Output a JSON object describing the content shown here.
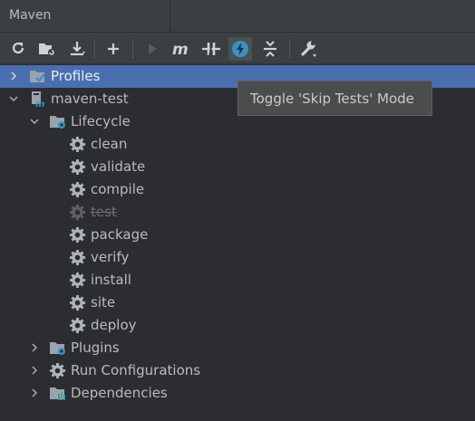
{
  "panel": {
    "title": "Maven"
  },
  "toolbar": {
    "buttons": [
      {
        "name": "reload-all-icon"
      },
      {
        "name": "add-project-folder-icon"
      },
      {
        "name": "download-icon"
      },
      {
        "name": "add-icon"
      },
      {
        "name": "run-icon",
        "disabled": true
      },
      {
        "name": "execute-goal-icon"
      },
      {
        "name": "toggle-offline-icon"
      },
      {
        "name": "skip-tests-icon",
        "active": true
      },
      {
        "name": "collapse-all-icon"
      },
      {
        "name": "settings-wrench-icon"
      }
    ]
  },
  "tooltip": {
    "text": "Toggle 'Skip Tests' Mode"
  },
  "tree": {
    "profiles": "Profiles",
    "project": "maven-test",
    "lifecycle": "Lifecycle",
    "goals": [
      "clean",
      "validate",
      "compile",
      "test",
      "package",
      "verify",
      "install",
      "site",
      "deploy"
    ],
    "disabled_goal": "test",
    "plugins": "Plugins",
    "run_configurations": "Run Configurations",
    "dependencies": "Dependencies"
  },
  "colors": {
    "background": "#2b2d30",
    "selection": "#4b6eaf",
    "accent_blue": "#3592c4",
    "folder_gray": "#8a9199"
  }
}
